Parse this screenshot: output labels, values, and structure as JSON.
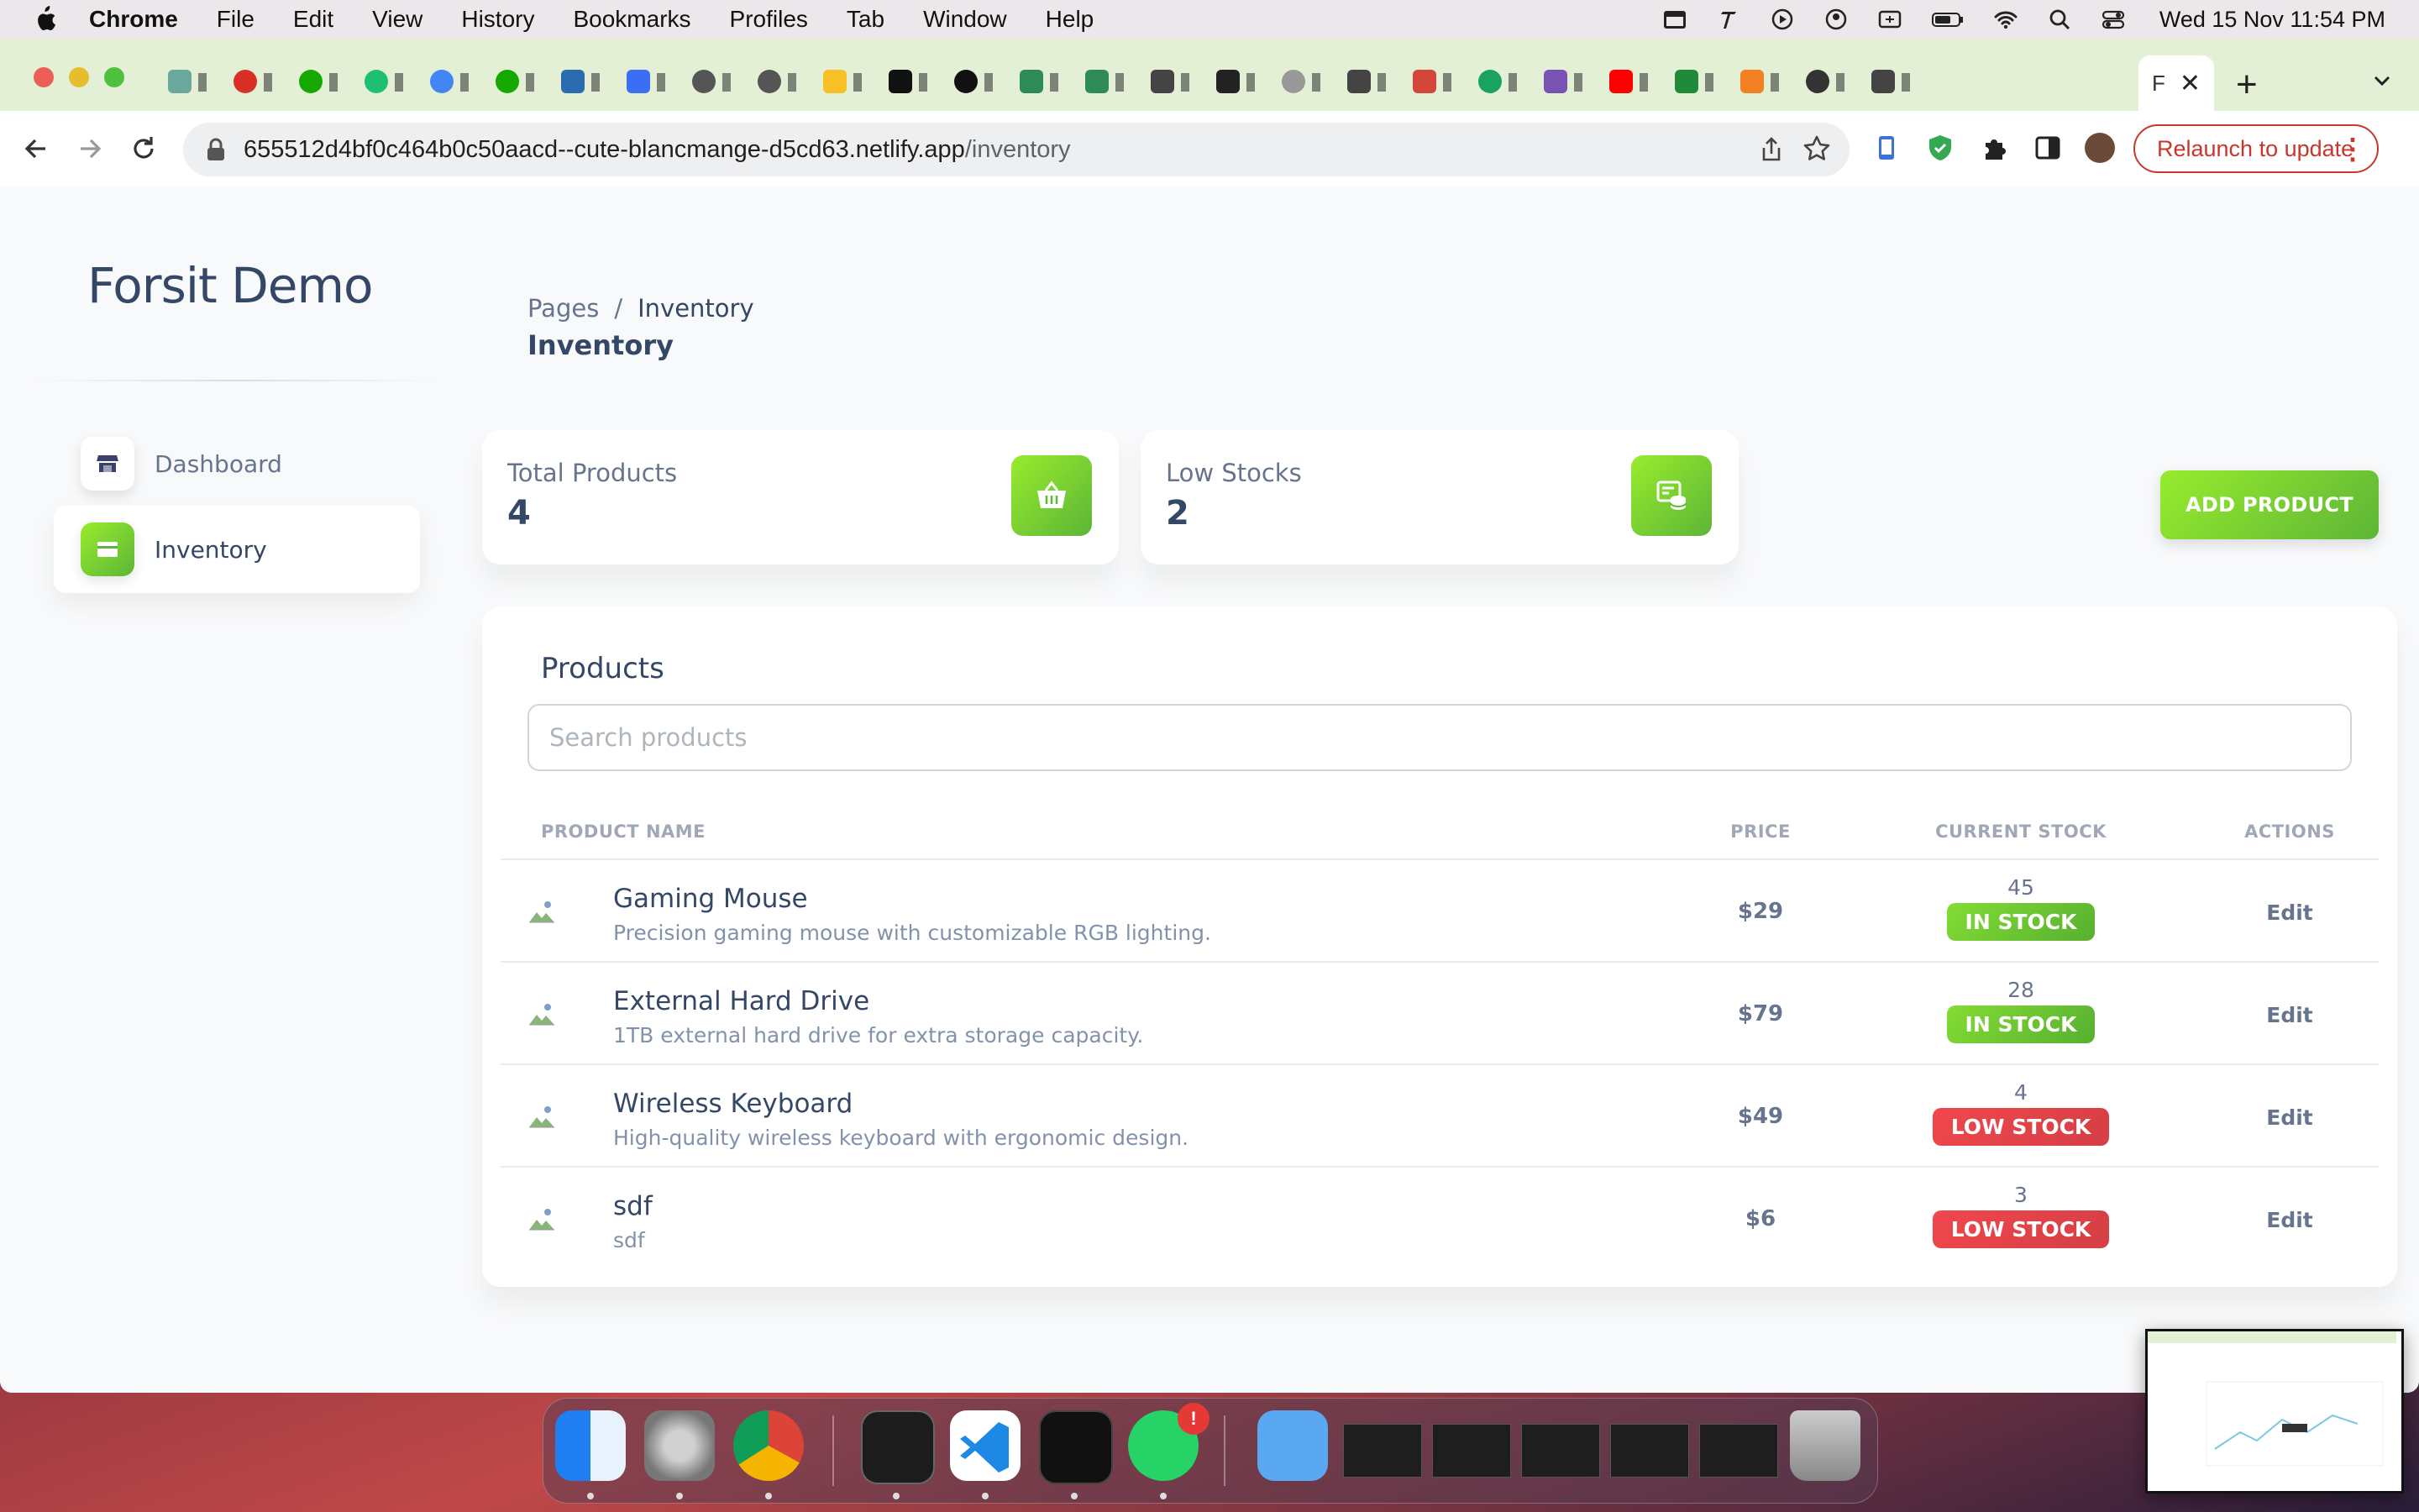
{
  "menubar": {
    "app_name": "Chrome",
    "items": [
      "File",
      "Edit",
      "View",
      "History",
      "Bookmarks",
      "Profiles",
      "Tab",
      "Window",
      "Help"
    ],
    "clock": "Wed 15 Nov  11:54 PM"
  },
  "browser": {
    "active_tab_label": "F",
    "url_host": "655512d4bf0c464b0c50aacd--cute-blancmange-d5cd63.netlify.app",
    "url_path": "/inventory",
    "relaunch_label": "Relaunch to update"
  },
  "sidebar": {
    "brand": "Forsit Demo",
    "items": [
      {
        "label": "Dashboard",
        "icon": "shop-icon",
        "active": false
      },
      {
        "label": "Inventory",
        "icon": "credit-card-icon",
        "active": true
      }
    ]
  },
  "breadcrumb": {
    "parent": "Pages",
    "separator": "/",
    "current": "Inventory"
  },
  "page_title": "Inventory",
  "stats": [
    {
      "label": "Total Products",
      "value": "4",
      "icon": "basket-icon"
    },
    {
      "label": "Low Stocks",
      "value": "2",
      "icon": "database-icon"
    }
  ],
  "add_product_label": "ADD PRODUCT",
  "products": {
    "title": "Products",
    "search_placeholder": "Search products",
    "columns": {
      "name": "PRODUCT NAME",
      "price": "PRICE",
      "stock": "CURRENT STOCK",
      "actions": "ACTIONS"
    },
    "rows": [
      {
        "name": "Gaming Mouse",
        "description": "Precision gaming mouse with customizable RGB lighting.",
        "price": "$29",
        "stock": "45",
        "status": "IN STOCK",
        "status_type": "in",
        "action": "Edit"
      },
      {
        "name": "External Hard Drive",
        "description": "1TB external hard drive for extra storage capacity.",
        "price": "$79",
        "stock": "28",
        "status": "IN STOCK",
        "status_type": "in",
        "action": "Edit"
      },
      {
        "name": "Wireless Keyboard",
        "description": "High-quality wireless keyboard with ergonomic design.",
        "price": "$49",
        "stock": "4",
        "status": "LOW STOCK",
        "status_type": "low",
        "action": "Edit"
      },
      {
        "name": "sdf",
        "description": "sdf",
        "price": "$6",
        "stock": "3",
        "status": "LOW STOCK",
        "status_type": "low",
        "action": "Edit"
      }
    ]
  },
  "dock": {
    "notification_count": "!"
  },
  "colors": {
    "accent": "#82d616",
    "accent_dark": "#5db536",
    "danger": "#ea0606",
    "text_dark": "#344767",
    "text_muted": "#67748e"
  }
}
